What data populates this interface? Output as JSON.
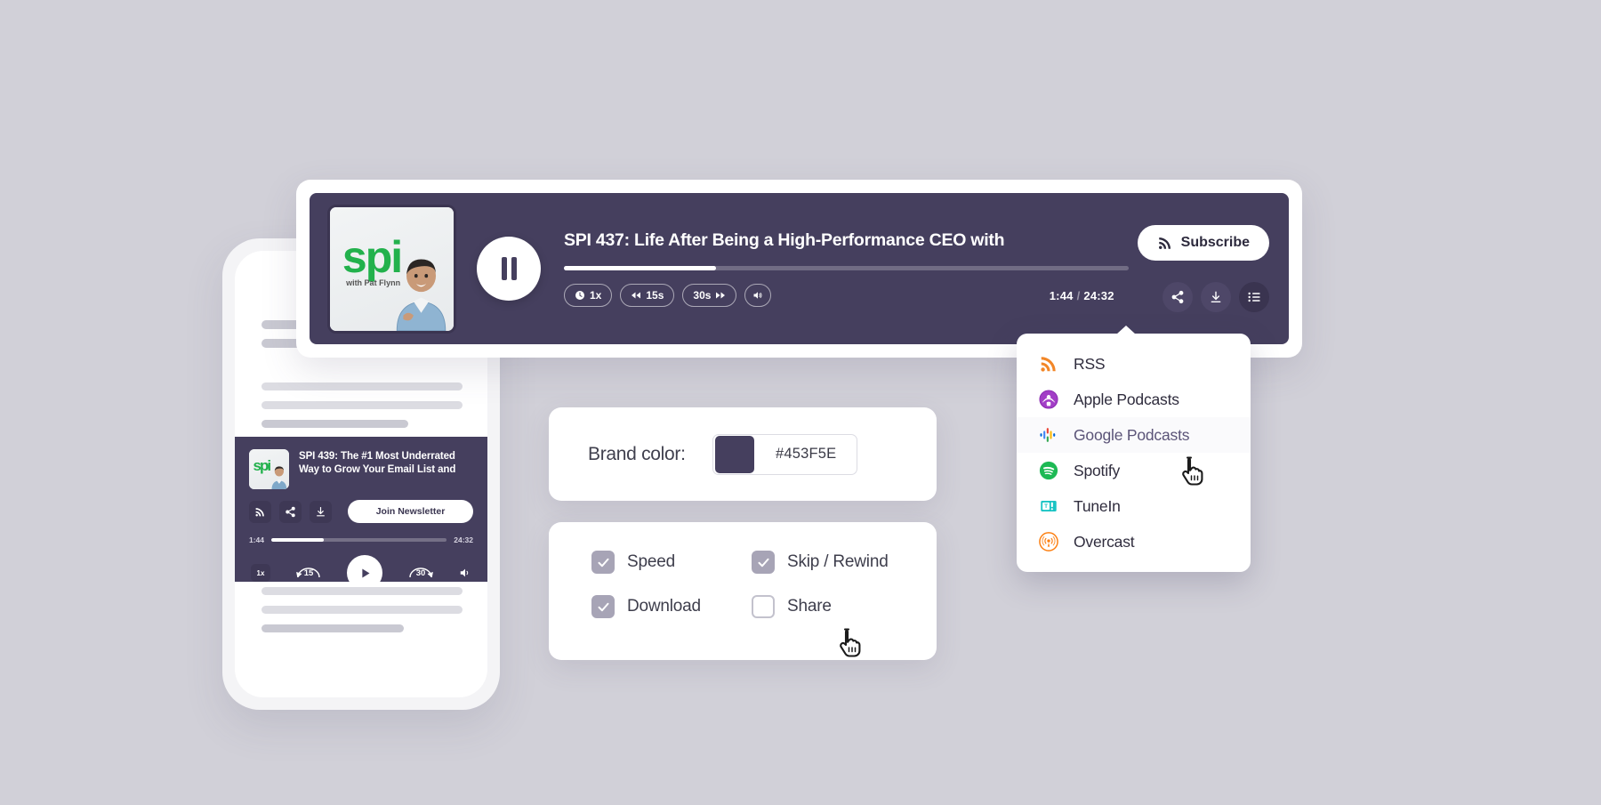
{
  "page": {
    "background_color": "#D1D0D8",
    "brand_color": "#453F5E"
  },
  "desktop_player": {
    "artwork": {
      "logo_text": "spi",
      "logo_subtitle": "with Pat Flynn",
      "alt": "SPI podcast cover art"
    },
    "play_button_state": "pause",
    "episode_title": "SPI 437: Life After Being a High-Performance CEO with",
    "progress_percent": 27,
    "controls": [
      {
        "name": "speed",
        "label": "1x",
        "icon": "clock-icon"
      },
      {
        "name": "rewind",
        "label": "15s",
        "icon": "rewind-icon"
      },
      {
        "name": "forward",
        "label": "30s",
        "icon": "forward-icon"
      },
      {
        "name": "volume",
        "label": "",
        "icon": "volume-icon"
      }
    ],
    "current_time": "1:44",
    "time_separator": "/",
    "total_time": "24:32",
    "subscribe_label": "Subscribe",
    "action_icons": [
      {
        "name": "share-icon",
        "active": false
      },
      {
        "name": "download-icon",
        "active": false
      },
      {
        "name": "playlist-icon",
        "active": true
      }
    ]
  },
  "subscribe_dropdown": {
    "items": [
      {
        "label": "RSS",
        "icon": "rss-icon",
        "hovered": false
      },
      {
        "label": "Apple Podcasts",
        "icon": "apple-podcasts-icon",
        "hovered": false
      },
      {
        "label": "Google Podcasts",
        "icon": "google-podcasts-icon",
        "hovered": true
      },
      {
        "label": "Spotify",
        "icon": "spotify-icon",
        "hovered": false
      },
      {
        "label": "TuneIn",
        "icon": "tunein-icon",
        "hovered": false
      },
      {
        "label": "Overcast",
        "icon": "overcast-icon",
        "hovered": false
      }
    ]
  },
  "mobile_preview": {
    "episode_title": "SPI 439: The #1 Most Underrated Way to Grow Your Email List and",
    "artwork_logo": "spi",
    "icons": [
      {
        "name": "rss-icon"
      },
      {
        "name": "share-icon"
      },
      {
        "name": "download-icon"
      }
    ],
    "cta_label": "Join Newsletter",
    "current_time": "1:44",
    "total_time": "24:32",
    "progress_percent": 30,
    "speed_label": "1x",
    "rewind_label": "15",
    "forward_label": "30",
    "play_button_state": "play"
  },
  "brand_color_card": {
    "label": "Brand color:",
    "hex_value": "#453F5E",
    "swatch_color": "#453F5E"
  },
  "features_card": {
    "options": [
      {
        "label": "Speed",
        "checked": true
      },
      {
        "label": "Skip / Rewind",
        "checked": true
      },
      {
        "label": "Download",
        "checked": true
      },
      {
        "label": "Share",
        "checked": false
      }
    ]
  },
  "cursors": [
    {
      "name": "pointer-cursor-menu",
      "target": "Google Podcasts"
    },
    {
      "name": "pointer-cursor-share",
      "target": "Share checkbox"
    }
  ]
}
